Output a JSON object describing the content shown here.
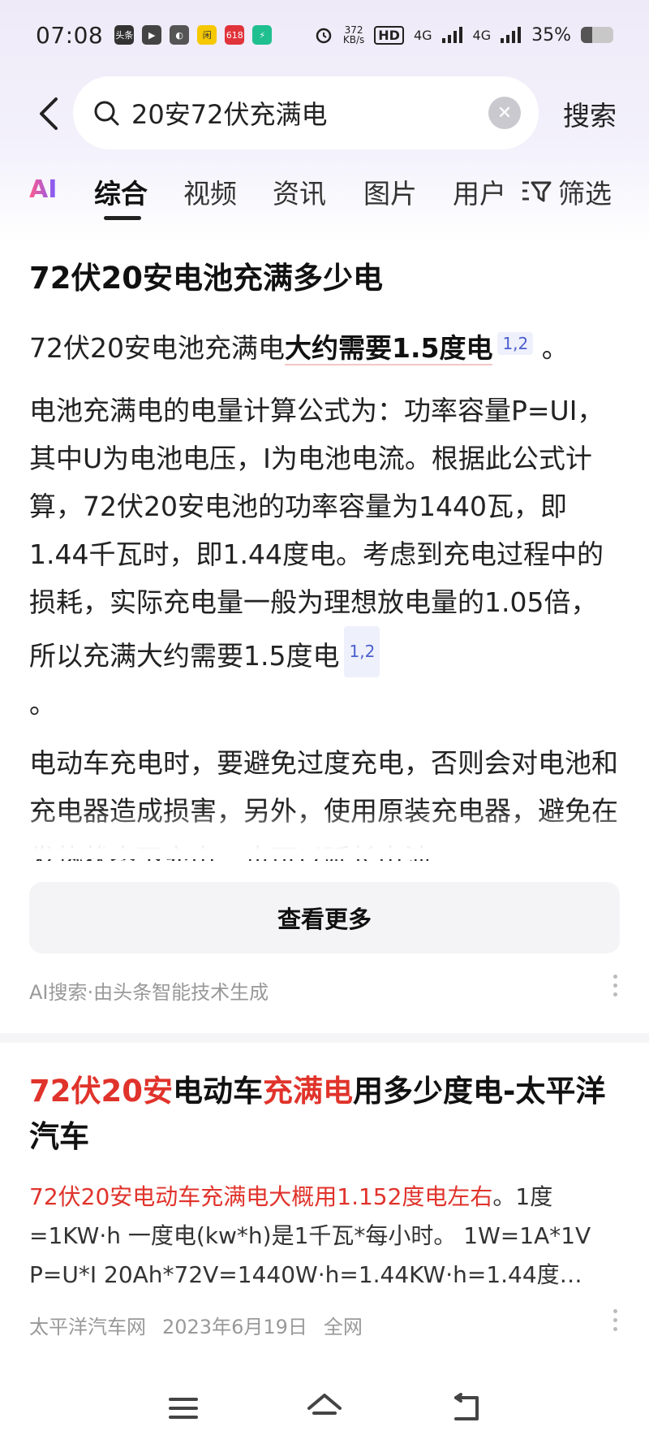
{
  "status": {
    "time": "07:08",
    "apps": [
      "头条",
      "▶",
      "◐",
      "闲",
      "618",
      "⚡"
    ],
    "net_speed_top": "372",
    "net_speed_bottom": "KB/s",
    "hd": "HD",
    "sig1": "4G",
    "sig2": "4G",
    "battery": "35%",
    "battery_level": 0.35
  },
  "search": {
    "query": "20安72伏充满电",
    "button": "搜索"
  },
  "tabs": {
    "ai": "AI",
    "items": [
      "综合",
      "视频",
      "资讯",
      "图片",
      "用户"
    ],
    "filter": "筛选"
  },
  "ai_answer": {
    "title": "72伏20安电池充满多少电",
    "summary_pre": "72伏20安电池充满电",
    "summary_bold": "大约需要1.5度电",
    "summary_cite": "1,2",
    "summary_end": "。",
    "para1": "电池充满电的电量计算公式为：功率容量P=UI，其中U为电池电压，I为电池电流。根据此公式计算，72伏20安电池的功率容量为1440瓦，即1.44千瓦时，即1.44度电。考虑到充电过程中的损耗，实际充电量一般为理想放电量的1.05倍，所以充满大约需要1.5度电",
    "para1_cite": "1,2",
    "para1_end": "。",
    "para2": "电动车充电时，要避免过度充电，否则会对电池和充电器造成损害，另外，使用原装充电器，避免在发热状态下充电，也可以延长电池",
    "more_button": "查看更多",
    "generated_by": "AI搜索·由头条智能技术生成"
  },
  "result": {
    "title_parts": [
      {
        "text": "72伏20安",
        "hl": true
      },
      {
        "text": "电动车",
        "hl": false
      },
      {
        "text": "充满电",
        "hl": true
      },
      {
        "text": "用多少度电-太平洋汽车",
        "hl": false
      }
    ],
    "snippet_hl": "72伏20安电动车充满电大概用1.152度电左右",
    "snippet_rest": "。1度=1KW·h 一度电(kw*h)是1千瓦*每小时。 1W=1A*1V P=U*I 20Ah*72V=1440W·h=1.44KW·h=1.44度…",
    "source": "太平洋汽车网",
    "date": "2023年6月19日",
    "scope": "全网"
  },
  "icons": [
    "back-arrow-icon",
    "search-icon",
    "clear-icon",
    "filter-icon",
    "more-dots-icon",
    "menu-icon",
    "home-icon",
    "back-nav-icon"
  ]
}
